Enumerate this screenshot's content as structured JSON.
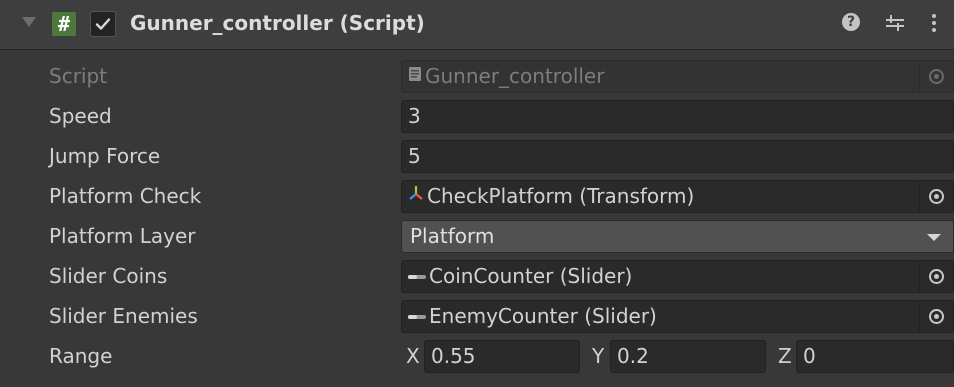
{
  "component": {
    "title": "Gunner_controller (Script)",
    "script_icon_glyph": "#",
    "enabled": true,
    "icons": [
      "fold-arrow-icon",
      "csharp-script-icon",
      "checkbox-icon",
      "help-icon",
      "presets-icon",
      "kebab-menu-icon"
    ]
  },
  "fields": {
    "script": {
      "label": "Script",
      "value": "Gunner_controller"
    },
    "speed": {
      "label": "Speed",
      "value": "3"
    },
    "jump_force": {
      "label": "Jump Force",
      "value": "5"
    },
    "platform_check": {
      "label": "Platform Check",
      "value": "CheckPlatform (Transform)"
    },
    "platform_layer": {
      "label": "Platform Layer",
      "value": "Platform"
    },
    "slider_coins": {
      "label": "Slider Coins",
      "value": "CoinCounter (Slider)"
    },
    "slider_enemies": {
      "label": "Slider Enemies",
      "value": "EnemyCounter (Slider)"
    },
    "range": {
      "label": "Range",
      "x_label": "X",
      "x": "0.55",
      "y_label": "Y",
      "y": "0.2",
      "z_label": "Z",
      "z": "0"
    }
  },
  "colors": {
    "background": "#383838",
    "header": "#3e3e3e",
    "field": "#2a2a2a",
    "dropdown": "#515151",
    "script_icon": "#4c7a3a"
  }
}
